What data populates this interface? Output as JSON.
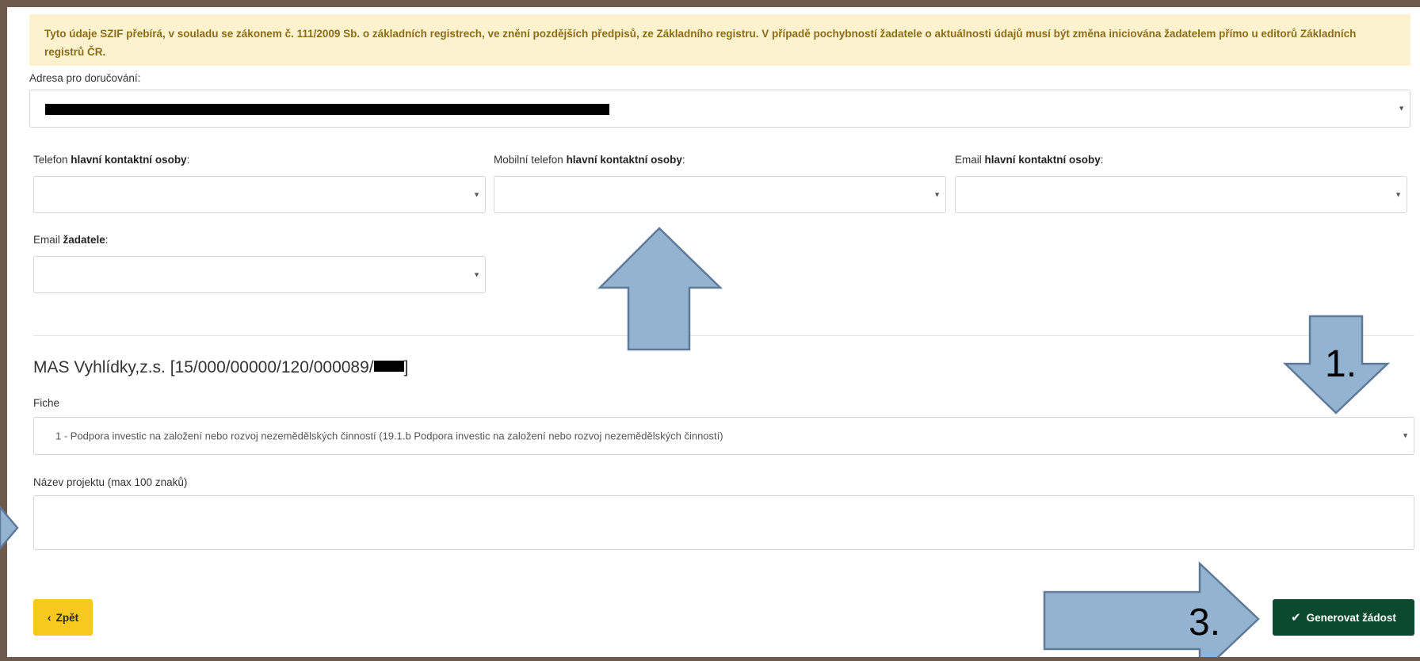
{
  "notice": {
    "text": "Tyto údaje SZIF přebírá, v souladu se zákonem č. 111/2009 Sb. o základních registrech, ve znění pozdějších předpisů, ze Základního registru. V případě pochybností žadatele o aktuálnosti údajů musí být změna iniciována žadatelem přímo u editorů Základních registrů ČR."
  },
  "address": {
    "label": "Adresa pro doručování:"
  },
  "contact": {
    "phone_prefix": "Telefon ",
    "phone_bold": "hlavní kontaktní osoby",
    "mobile_prefix": "Mobilní telefon ",
    "mobile_bold": "hlavní kontaktní osoby",
    "email_prefix": "Email ",
    "email_bold": "hlavní kontaktní osoby",
    "applicant_email_prefix": "Email ",
    "applicant_email_bold": "žadatele",
    "colon": ":"
  },
  "mas": {
    "title_prefix": "MAS Vyhlídky,z.s. [15/000/00000/120/000089/",
    "title_suffix": "]"
  },
  "fiche": {
    "label": "Fiche",
    "selected": "1 - Podpora investic na založení nebo rozvoj nezemědělských činností (19.1.b Podpora investic na založení nebo rozvoj nezemědělských činností)"
  },
  "project": {
    "label": "Název projektu (max 100 znaků)"
  },
  "buttons": {
    "back": "Zpět",
    "generate": "Generovat žádost"
  },
  "annotations": {
    "step1": "1.",
    "step3": "3."
  },
  "colors": {
    "notice_bg": "#fcf2ce",
    "notice_text": "#8a6d1c",
    "back_button": "#f7c81d",
    "generate_button": "#0b4a2e",
    "arrow_fill": "#94b3d1",
    "arrow_stroke": "#5f7a99",
    "frame": "#6e574b"
  }
}
